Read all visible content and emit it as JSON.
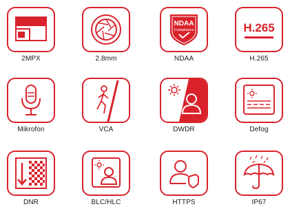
{
  "accent_color": "#d9222b",
  "features": [
    {
      "label": "2MPX",
      "icon": "resolution-icon"
    },
    {
      "label": "2.8mm",
      "icon": "lens-aperture-icon"
    },
    {
      "label": "NDAA",
      "icon": "ndaa-compliance-badge-icon",
      "badge_text": [
        "NDAA",
        "Compliance"
      ]
    },
    {
      "label": "H.265",
      "icon": "h265-codec-icon",
      "badge_text": "H.265"
    },
    {
      "label": "Mikrofon",
      "icon": "microphone-icon"
    },
    {
      "label": "VCA",
      "icon": "walking-person-tripwire-icon"
    },
    {
      "label": "DWDR",
      "icon": "sun-person-contrast-icon"
    },
    {
      "label": "Defog",
      "icon": "fog-sun-icon"
    },
    {
      "label": "DNR",
      "icon": "noise-reduction-icon"
    },
    {
      "label": "BLC/HLC",
      "icon": "backlight-person-icon"
    },
    {
      "label": "HTTPS",
      "icon": "user-shield-icon"
    },
    {
      "label": "IP67",
      "icon": "umbrella-rain-icon"
    }
  ]
}
